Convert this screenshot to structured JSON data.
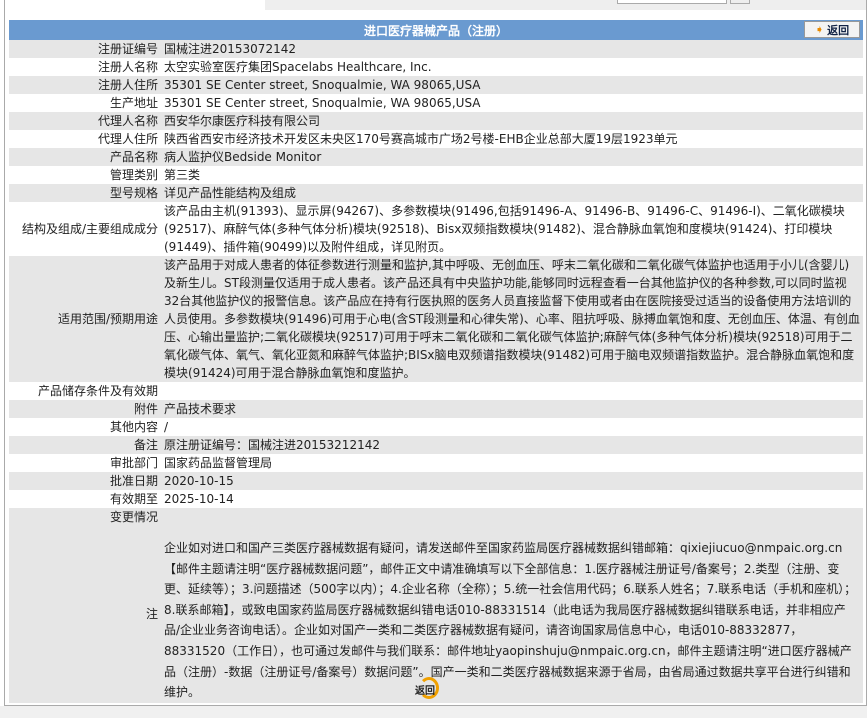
{
  "header": {
    "title": "进口医疗器械产品（注册）",
    "back_label": "返回"
  },
  "rows": [
    {
      "k": "注册证编号",
      "v": "国械注进20153072142"
    },
    {
      "k": "注册人名称",
      "v": "太空实验室医疗集团Spacelabs Healthcare, Inc."
    },
    {
      "k": "注册人住所",
      "v": "35301 SE Center street, Snoqualmie, WA 98065,USA"
    },
    {
      "k": "生产地址",
      "v": "35301 SE Center street, Snoqualmie, WA 98065,USA"
    },
    {
      "k": "代理人名称",
      "v": "西安华尔康医疗科技有限公司"
    },
    {
      "k": "代理人住所",
      "v": "陕西省西安市经济技术开发区未央区170号赛高城市广场2号楼-EHB企业总部大厦19层1923单元"
    },
    {
      "k": "产品名称",
      "v": "病人监护仪Bedside Monitor"
    },
    {
      "k": "管理类别",
      "v": "第三类"
    },
    {
      "k": "型号规格",
      "v": "详见产品性能结构及组成"
    },
    {
      "k": "结构及组成/主要组成成分",
      "v": "该产品由主机(91393)、显示屏(94267)、多参数模块(91496,包括91496-A、91496-B、91496-C、91496-I)、二氧化碳模块(92517)、麻醉气体(多种气体分析)模块(92518)、Bisx双频指数模块(91482)、混合静脉血氧饱和度模块(91424)、打印模块(91449)、插件箱(90499)以及附件组成，详见附页。"
    },
    {
      "k": "适用范围/预期用途",
      "v": "该产品用于对成人患者的体征参数进行测量和监护,其中呼吸、无创血压、呼末二氧化碳和二氧化碳气体监护也适用于小儿(含婴儿)及新生儿。ST段测量仅适用于成人患者。该产品还具有中央监护功能,能够同时远程查看一台其他监护仪的各种参数,可以同时监视32台其他监护仪的报警信息。该产品应在持有行医执照的医务人员直接监督下使用或者由在医院接受过适当的设备使用方法培训的人员使用。多参数模块(91496)可用于心电(含ST段测量和心律失常)、心率、阻抗呼吸、脉搏血氧饱和度、无创血压、体温、有创血压、心输出量监护;二氧化碳模块(92517)可用于呼末二氧化碳和二氧化碳气体监护;麻醉气体(多种气体分析)模块(92518)可用于二氧化碳气体、氧气、氧化亚氮和麻醉气体监护;BISx脑电双频谱指数模块(91482)可用于脑电双频谱指数监护。混合静脉血氧饱和度模块(91424)可用于混合静脉血氧饱和度监护。"
    },
    {
      "k": "产品储存条件及有效期",
      "v": ""
    },
    {
      "k": "附件",
      "v": "产品技术要求"
    },
    {
      "k": "其他内容",
      "v": "/"
    },
    {
      "k": "备注",
      "v": "原注册证编号：国械注进20153212142"
    },
    {
      "k": "审批部门",
      "v": "国家药品监督管理局"
    },
    {
      "k": "批准日期",
      "v": "2020-10-15"
    },
    {
      "k": "有效期至",
      "v": "2025-10-14"
    },
    {
      "k": "变更情况",
      "v": ""
    }
  ],
  "note": {
    "k": "注",
    "v": "企业如对进口和国产三类医疗器械数据有疑问，请发送邮件至国家药监局医疗器械数据纠错邮箱：qixiejiucuo@nmpaic.org.cn【邮件主题请注明“医疗器械数据问题”，邮件正文中请准确填写以下全部信息：1.医疗器械注册证号/备案号；2.类型（注册、变更、延续等）；3.问题描述（500字以内）；4.企业名称（全称）；5.统一社会信用代码；6.联系人姓名；7.联系电话（手机和座机）；8.联系邮箱】，或致电国家药监局医疗器械数据纠错电话010-88331514（此电话为我局医疗器械数据纠错联系电话，并非相应产品/企业业务咨询电话）。企业如对国产一类和二类医疗器械数据有疑问，请咨询国家局信息中心，电话010-88332877，88331520（工作日），也可通过发邮件与我们联系：邮件地址yaopinshuju@nmpaic.org.cn，邮件主题请注明“进口医疗器械产品（注册）-数据（注册证号/备案号）数据问题”。国产一类和二类医疗器械数据来源于省局，由省局通过数据共享平台进行纠错和维护。"
  },
  "footer": {
    "back_label": "返回"
  }
}
